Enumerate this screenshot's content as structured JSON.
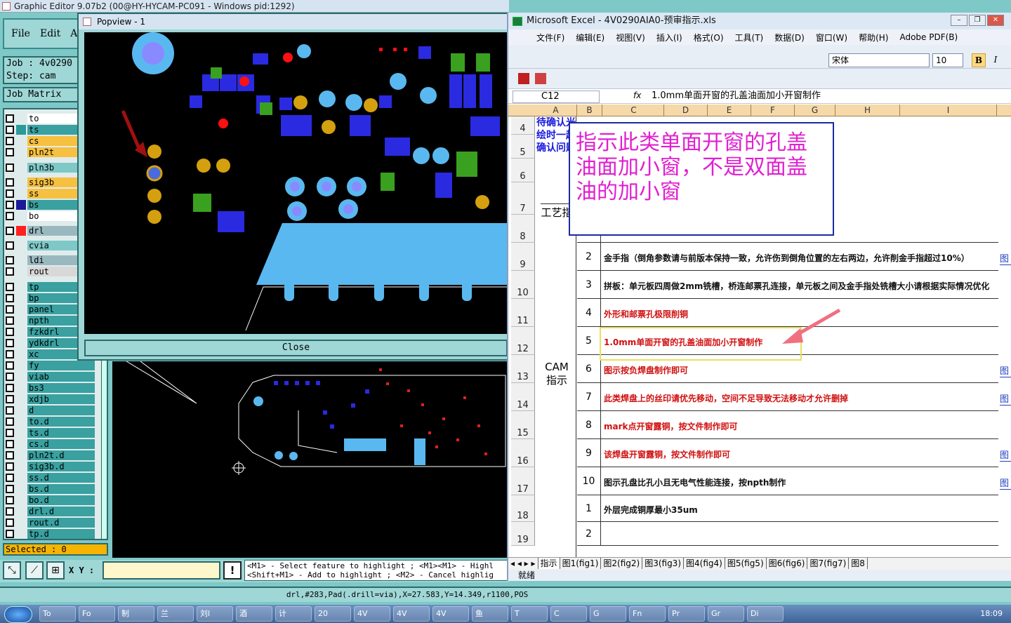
{
  "ge": {
    "title": "Graphic Editor 9.07b2 (00@HY-HYCAM-PC091 - Windows pid:1292)",
    "menu": [
      "File",
      "Edit",
      "A"
    ],
    "job": "Job : 4v0290",
    "step": "Step: cam",
    "job_matrix": "Job Matrix",
    "layers": [
      {
        "name": "to",
        "color": "#ffffff",
        "sw": "#e0ecec"
      },
      {
        "name": "ts",
        "color": "#3aa0a0",
        "sw": "#2a9a9a"
      },
      {
        "name": "cs",
        "color": "#f6c040",
        "sw": "#e0ecec"
      },
      {
        "name": "pln2t",
        "color": "#f6c040",
        "sw": "#e0ecec"
      },
      {
        "name": "pln3b",
        "color": "#7fc8c8",
        "sw": "#e0ecec"
      },
      {
        "name": "sig3b",
        "color": "#f6c040",
        "sw": "#e0ecec"
      },
      {
        "name": "ss",
        "color": "#f6c040",
        "sw": "#e0ecec"
      },
      {
        "name": "bs",
        "color": "#3aa0a0",
        "sw": "#1a1a9a"
      },
      {
        "name": "bo",
        "color": "#ffffff",
        "sw": "#e0ecec"
      },
      {
        "name": "drl",
        "color": "#9ab8c0",
        "sw": "#ff2020"
      },
      {
        "name": "cvia",
        "color": "#7fc8c8",
        "sw": "#e0ecec"
      },
      {
        "name": "ldi",
        "color": "#9ab8c0",
        "sw": "#e0ecec"
      },
      {
        "name": "rout",
        "color": "#d8d8d8",
        "sw": "#e0ecec"
      },
      {
        "name": "tp",
        "color": "#3aa0a0",
        "sw": "#e0ecec"
      },
      {
        "name": "bp",
        "color": "#3aa0a0",
        "sw": "#e0ecec"
      },
      {
        "name": "panel",
        "color": "#3aa0a0",
        "sw": "#e0ecec"
      },
      {
        "name": "npth",
        "color": "#3aa0a0",
        "sw": "#e0ecec"
      },
      {
        "name": "fzkdrl",
        "color": "#3aa0a0",
        "sw": "#e0ecec"
      },
      {
        "name": "ydkdrl",
        "color": "#3aa0a0",
        "sw": "#e0ecec"
      },
      {
        "name": "xc",
        "color": "#3aa0a0",
        "sw": "#e0ecec"
      },
      {
        "name": "fy",
        "color": "#3aa0a0",
        "sw": "#e0ecec"
      },
      {
        "name": "viab",
        "color": "#3aa0a0",
        "sw": "#e0ecec"
      },
      {
        "name": "bs3",
        "color": "#3aa0a0",
        "sw": "#e0ecec"
      },
      {
        "name": "xdjb",
        "color": "#3aa0a0",
        "sw": "#e0ecec"
      },
      {
        "name": "d",
        "color": "#3aa0a0",
        "sw": "#e0ecec"
      },
      {
        "name": "to.d",
        "color": "#3aa0a0",
        "sw": "#e0ecec"
      },
      {
        "name": "ts.d",
        "color": "#3aa0a0",
        "sw": "#e0ecec"
      },
      {
        "name": "cs.d",
        "color": "#3aa0a0",
        "sw": "#e0ecec"
      },
      {
        "name": "pln2t.d",
        "color": "#3aa0a0",
        "sw": "#e0ecec"
      },
      {
        "name": "sig3b.d",
        "color": "#3aa0a0",
        "sw": "#e0ecec"
      },
      {
        "name": "ss.d",
        "color": "#3aa0a0",
        "sw": "#e0ecec"
      },
      {
        "name": "bs.d",
        "color": "#3aa0a0",
        "sw": "#e0ecec"
      },
      {
        "name": "bo.d",
        "color": "#3aa0a0",
        "sw": "#e0ecec"
      },
      {
        "name": "drl.d",
        "color": "#3aa0a0",
        "sw": "#e0ecec"
      },
      {
        "name": "rout.d",
        "color": "#3aa0a0",
        "sw": "#e0ecec"
      },
      {
        "name": "tp.d",
        "color": "#3aa0a0",
        "sw": "#e0ecec"
      }
    ],
    "selected": "Selected : 0",
    "xy_label": "X Y :",
    "hint_line1": "<M1> - Select feature to highlight ; <M1><M1> - Highl",
    "hint_line2": "<Shift+M1> - Add to highlight ; <M2> - Cancel highlig",
    "status": "drl,#283,Pad(.drill=via),X=27.583,Y=14.349,r1100,POS"
  },
  "popview": {
    "title": "Popview - 1",
    "close": "Close"
  },
  "excel": {
    "title": "Microsoft Excel - 4V0290AIA0-预审指示.xls",
    "menu": [
      "文件(F)",
      "编辑(E)",
      "视图(V)",
      "插入(I)",
      "格式(O)",
      "工具(T)",
      "数据(D)",
      "窗口(W)",
      "帮助(H)",
      "Adobe PDF(B)"
    ],
    "font": "宋体",
    "size": "10",
    "bold": "B",
    "italic": "I",
    "namebox": "C12",
    "fx": "fx",
    "formula": "1.0mm单面开窗的孔盖油面加小开窗制作",
    "cols": [
      "A",
      "B",
      "C",
      "D",
      "E",
      "F",
      "G",
      "H",
      "I"
    ],
    "rows": [
      {
        "r": "4",
        "h": 26
      },
      {
        "r": "5",
        "h": 34
      },
      {
        "r": "6",
        "h": 34
      },
      {
        "r": "7",
        "h": 46
      },
      {
        "r": "8",
        "h": 40
      },
      {
        "r": "9",
        "h": 40
      },
      {
        "r": "10",
        "h": 40
      },
      {
        "r": "11",
        "h": 40
      },
      {
        "r": "12",
        "h": 40
      },
      {
        "r": "13",
        "h": 40
      },
      {
        "r": "14",
        "h": 40
      },
      {
        "r": "15",
        "h": 40
      },
      {
        "r": "16",
        "h": 40
      },
      {
        "r": "17",
        "h": 40
      },
      {
        "r": "18",
        "h": 38
      },
      {
        "r": "19",
        "h": 34
      }
    ],
    "left_a_text": "待确认光绘时一起确认问题",
    "gongyi": "工艺指",
    "cam_label": "CAM指示",
    "items": [
      {
        "n": "",
        "text": "",
        "color": "blk",
        "link": ""
      },
      {
        "n": "2",
        "text": "金手指（倒角参数请与前版本保持一致，允许伤到倒角位置的左右两边，允许削金手指超过10%）",
        "color": "blk",
        "link": "图"
      },
      {
        "n": "3",
        "text": "拼板：单元板四周做2mm铣槽，桥连邮票孔连接，单元板之间及金手指处铣槽大小请根据实际情况优化",
        "color": "blk",
        "link": ""
      },
      {
        "n": "4",
        "text": "外形和邮票孔极限削铜",
        "color": "red",
        "link": ""
      },
      {
        "n": "5",
        "text": "1.0mm单面开窗的孔盖油面加小开窗制作",
        "color": "red",
        "link": ""
      },
      {
        "n": "6",
        "text": "图示按负焊盘制作即可",
        "color": "red",
        "link": "图"
      },
      {
        "n": "7",
        "text": "此类焊盘上的丝印请优先移动，空间不足导致无法移动才允许删掉",
        "color": "red",
        "link": "图"
      },
      {
        "n": "8",
        "text": "mark点开窗露铜，按文件制作即可",
        "color": "red",
        "link": ""
      },
      {
        "n": "9",
        "text": "该焊盘开窗露铜，按文件制作即可",
        "color": "red",
        "link": "图"
      },
      {
        "n": "10",
        "text": "图示孔盘比孔小且无电气性能连接，按npth制作",
        "color": "blk",
        "link": "图"
      },
      {
        "n": "1",
        "text": "外层完成铜厚最小35um",
        "color": "blk",
        "link": ""
      },
      {
        "n": "2",
        "text": "",
        "color": "blk",
        "link": ""
      }
    ],
    "note": "指示此类单面开窗的孔盖油面加小窗，不是双面盖油的加小窗",
    "tabs": [
      "指示",
      "图1(fig1)",
      "图2(fig2)",
      "图3(fig3)",
      "图4(fig4)",
      "图5(fig5)",
      "图6(fig6)",
      "图7(fig7)",
      "图8"
    ],
    "status": "就绪"
  },
  "taskbar": {
    "buttons": [
      "To",
      "Fo",
      "制",
      "兰",
      "刘l",
      "酒",
      "计",
      "20",
      "4V",
      "4V",
      "4V",
      "鱼",
      "T",
      "C",
      "G",
      "Fn",
      "Pr",
      "Gr",
      "Di"
    ],
    "clock": "18:09"
  },
  "colors": {
    "pad_yellow": "#d4a010",
    "pad_blue": "#4a6ae0",
    "mask_cyan": "#5ab8f0",
    "copper_blue": "#1a1ae0",
    "green": "#3aa020",
    "red": "#ff1010"
  }
}
